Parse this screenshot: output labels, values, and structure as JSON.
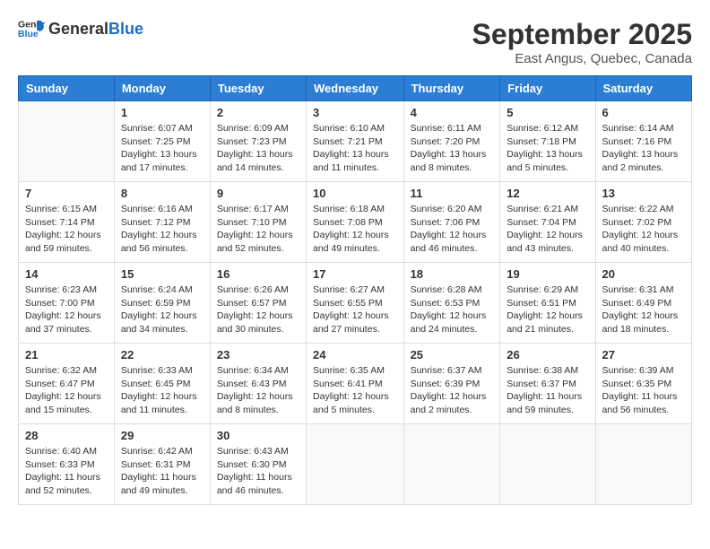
{
  "header": {
    "logo_general": "General",
    "logo_blue": "Blue",
    "month": "September 2025",
    "location": "East Angus, Quebec, Canada"
  },
  "weekdays": [
    "Sunday",
    "Monday",
    "Tuesday",
    "Wednesday",
    "Thursday",
    "Friday",
    "Saturday"
  ],
  "weeks": [
    [
      {
        "day": "",
        "info": ""
      },
      {
        "day": "1",
        "info": "Sunrise: 6:07 AM\nSunset: 7:25 PM\nDaylight: 13 hours\nand 17 minutes."
      },
      {
        "day": "2",
        "info": "Sunrise: 6:09 AM\nSunset: 7:23 PM\nDaylight: 13 hours\nand 14 minutes."
      },
      {
        "day": "3",
        "info": "Sunrise: 6:10 AM\nSunset: 7:21 PM\nDaylight: 13 hours\nand 11 minutes."
      },
      {
        "day": "4",
        "info": "Sunrise: 6:11 AM\nSunset: 7:20 PM\nDaylight: 13 hours\nand 8 minutes."
      },
      {
        "day": "5",
        "info": "Sunrise: 6:12 AM\nSunset: 7:18 PM\nDaylight: 13 hours\nand 5 minutes."
      },
      {
        "day": "6",
        "info": "Sunrise: 6:14 AM\nSunset: 7:16 PM\nDaylight: 13 hours\nand 2 minutes."
      }
    ],
    [
      {
        "day": "7",
        "info": "Sunrise: 6:15 AM\nSunset: 7:14 PM\nDaylight: 12 hours\nand 59 minutes."
      },
      {
        "day": "8",
        "info": "Sunrise: 6:16 AM\nSunset: 7:12 PM\nDaylight: 12 hours\nand 56 minutes."
      },
      {
        "day": "9",
        "info": "Sunrise: 6:17 AM\nSunset: 7:10 PM\nDaylight: 12 hours\nand 52 minutes."
      },
      {
        "day": "10",
        "info": "Sunrise: 6:18 AM\nSunset: 7:08 PM\nDaylight: 12 hours\nand 49 minutes."
      },
      {
        "day": "11",
        "info": "Sunrise: 6:20 AM\nSunset: 7:06 PM\nDaylight: 12 hours\nand 46 minutes."
      },
      {
        "day": "12",
        "info": "Sunrise: 6:21 AM\nSunset: 7:04 PM\nDaylight: 12 hours\nand 43 minutes."
      },
      {
        "day": "13",
        "info": "Sunrise: 6:22 AM\nSunset: 7:02 PM\nDaylight: 12 hours\nand 40 minutes."
      }
    ],
    [
      {
        "day": "14",
        "info": "Sunrise: 6:23 AM\nSunset: 7:00 PM\nDaylight: 12 hours\nand 37 minutes."
      },
      {
        "day": "15",
        "info": "Sunrise: 6:24 AM\nSunset: 6:59 PM\nDaylight: 12 hours\nand 34 minutes."
      },
      {
        "day": "16",
        "info": "Sunrise: 6:26 AM\nSunset: 6:57 PM\nDaylight: 12 hours\nand 30 minutes."
      },
      {
        "day": "17",
        "info": "Sunrise: 6:27 AM\nSunset: 6:55 PM\nDaylight: 12 hours\nand 27 minutes."
      },
      {
        "day": "18",
        "info": "Sunrise: 6:28 AM\nSunset: 6:53 PM\nDaylight: 12 hours\nand 24 minutes."
      },
      {
        "day": "19",
        "info": "Sunrise: 6:29 AM\nSunset: 6:51 PM\nDaylight: 12 hours\nand 21 minutes."
      },
      {
        "day": "20",
        "info": "Sunrise: 6:31 AM\nSunset: 6:49 PM\nDaylight: 12 hours\nand 18 minutes."
      }
    ],
    [
      {
        "day": "21",
        "info": "Sunrise: 6:32 AM\nSunset: 6:47 PM\nDaylight: 12 hours\nand 15 minutes."
      },
      {
        "day": "22",
        "info": "Sunrise: 6:33 AM\nSunset: 6:45 PM\nDaylight: 12 hours\nand 11 minutes."
      },
      {
        "day": "23",
        "info": "Sunrise: 6:34 AM\nSunset: 6:43 PM\nDaylight: 12 hours\nand 8 minutes."
      },
      {
        "day": "24",
        "info": "Sunrise: 6:35 AM\nSunset: 6:41 PM\nDaylight: 12 hours\nand 5 minutes."
      },
      {
        "day": "25",
        "info": "Sunrise: 6:37 AM\nSunset: 6:39 PM\nDaylight: 12 hours\nand 2 minutes."
      },
      {
        "day": "26",
        "info": "Sunrise: 6:38 AM\nSunset: 6:37 PM\nDaylight: 11 hours\nand 59 minutes."
      },
      {
        "day": "27",
        "info": "Sunrise: 6:39 AM\nSunset: 6:35 PM\nDaylight: 11 hours\nand 56 minutes."
      }
    ],
    [
      {
        "day": "28",
        "info": "Sunrise: 6:40 AM\nSunset: 6:33 PM\nDaylight: 11 hours\nand 52 minutes."
      },
      {
        "day": "29",
        "info": "Sunrise: 6:42 AM\nSunset: 6:31 PM\nDaylight: 11 hours\nand 49 minutes."
      },
      {
        "day": "30",
        "info": "Sunrise: 6:43 AM\nSunset: 6:30 PM\nDaylight: 11 hours\nand 46 minutes."
      },
      {
        "day": "",
        "info": ""
      },
      {
        "day": "",
        "info": ""
      },
      {
        "day": "",
        "info": ""
      },
      {
        "day": "",
        "info": ""
      }
    ]
  ]
}
